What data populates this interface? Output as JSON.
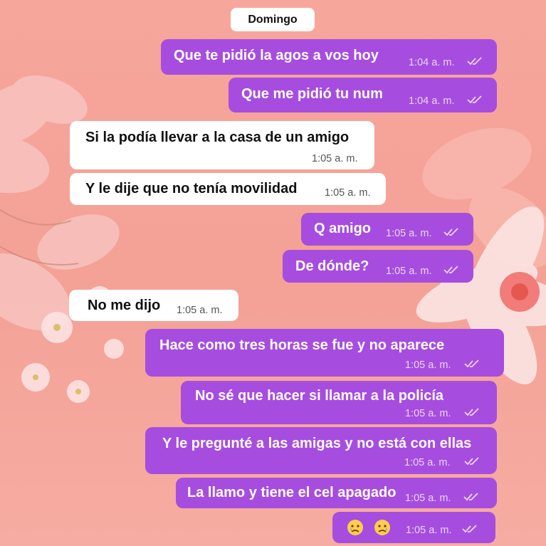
{
  "date_chip": "Domingo",
  "messages": [
    {
      "text": "Que te pidió la agos a vos hoy",
      "time": "1:04 a. m."
    },
    {
      "text": "Que me pidió tu num",
      "time": "1:04 a. m."
    },
    {
      "text": "Si la podía llevar a la casa de un amigo",
      "time": "1:05 a. m."
    },
    {
      "text": "Y le dije que no tenía movilidad",
      "time": "1:05 a. m."
    },
    {
      "text": "Q amigo",
      "time": "1:05 a. m."
    },
    {
      "text": "De dónde?",
      "time": "1:05 a. m."
    },
    {
      "text": "No me dijo",
      "time": "1:05 a. m."
    },
    {
      "text": "Hace como tres horas se fue y no aparece",
      "time": "1:05 a. m."
    },
    {
      "text": "No sé que hacer si llamar a la policía",
      "time": "1:05 a. m."
    },
    {
      "text": "Y le pregunté a las amigas y no está con ellas",
      "time": "1:05 a. m."
    },
    {
      "text": "La llamo y tiene el cel apagado",
      "time": "1:05 a. m."
    },
    {
      "text": "",
      "time": "1:05 a. m.",
      "emoji": [
        "sad-tear-emoji",
        "sad-tear-emoji"
      ]
    }
  ],
  "colors": {
    "sent_bubble": "#a64ddf",
    "received_bubble": "#ffffff",
    "background": "#f4a196"
  },
  "icons": {
    "read_receipt": "double-check-icon"
  }
}
